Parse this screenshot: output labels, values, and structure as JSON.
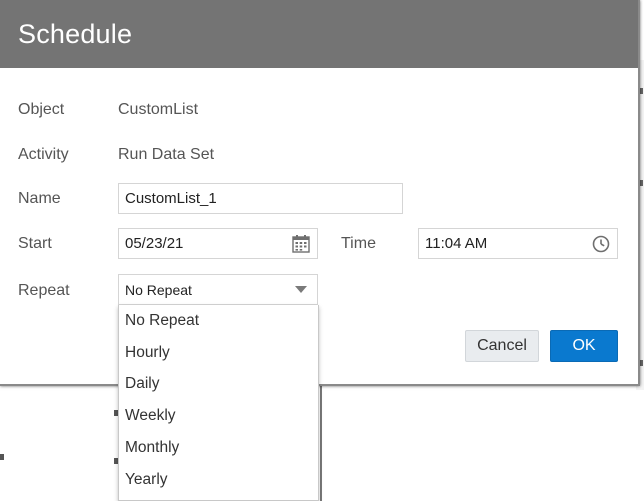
{
  "dialog": {
    "title": "Schedule",
    "object": {
      "label": "Object",
      "value": "CustomList"
    },
    "activity": {
      "label": "Activity",
      "value": "Run Data Set"
    },
    "name": {
      "label": "Name",
      "value": "CustomList_1"
    },
    "start": {
      "label": "Start",
      "date": "05/23/21"
    },
    "time": {
      "label": "Time",
      "value": "11:04 AM"
    },
    "repeat": {
      "label": "Repeat",
      "selected": "No Repeat",
      "options": [
        "No Repeat",
        "Hourly",
        "Daily",
        "Weekly",
        "Monthly",
        "Yearly"
      ]
    },
    "buttons": {
      "cancel": "Cancel",
      "ok": "OK"
    }
  },
  "colors": {
    "header_bg": "#747474",
    "ok_button": "#0a79cf",
    "cancel_button": "#e9ecef"
  },
  "icons": {
    "calendar": "calendar-icon",
    "clock": "clock-icon",
    "dropdown": "chevron-down-icon"
  }
}
